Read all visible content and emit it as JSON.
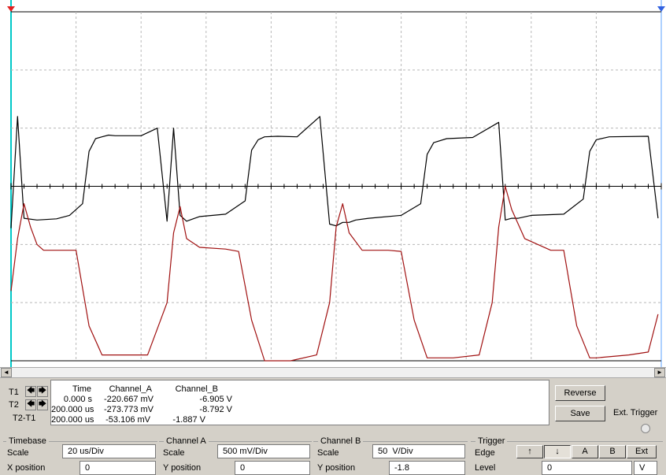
{
  "chart_data": {
    "type": "line",
    "title": "",
    "xlabel": "",
    "ylabel": "",
    "grid": true,
    "x_divisions": 10,
    "y_divisions": 6,
    "timebase_us_per_div": 20,
    "series": [
      {
        "channel": "Channel A",
        "color": "#000000",
        "x": [
          0,
          2,
          4,
          8,
          14,
          18,
          22,
          24,
          26,
          28,
          30,
          32,
          40,
          45,
          48,
          50,
          52,
          54,
          56,
          58,
          66,
          72,
          74,
          76,
          78,
          82,
          88,
          95,
          98,
          100,
          102,
          104,
          106,
          110,
          120,
          126,
          128,
          130,
          134,
          142,
          150,
          152,
          154,
          156,
          160,
          170,
          176,
          178,
          180,
          184,
          196,
          199
        ],
        "y": [
          -0.72,
          1.2,
          -0.55,
          -0.58,
          -0.56,
          -0.5,
          -0.3,
          0.6,
          0.82,
          0.85,
          0.88,
          0.87,
          0.87,
          1.0,
          -0.6,
          1.0,
          -0.5,
          -0.6,
          -0.56,
          -0.52,
          -0.48,
          -0.25,
          0.62,
          0.8,
          0.85,
          0.86,
          0.85,
          1.2,
          -0.65,
          -0.68,
          -0.62,
          -0.62,
          -0.58,
          -0.55,
          -0.5,
          -0.3,
          0.55,
          0.75,
          0.82,
          0.84,
          1.1,
          -0.58,
          -0.55,
          -0.55,
          -0.5,
          -0.48,
          -0.22,
          0.6,
          0.8,
          0.85,
          0.86,
          -0.55
        ]
      },
      {
        "channel": "Channel B",
        "color": "#a01010",
        "x": [
          0,
          2,
          4,
          6,
          8,
          10,
          14,
          20,
          24,
          28,
          30,
          34,
          42,
          48,
          50,
          52,
          54,
          58,
          66,
          70,
          74,
          78,
          80,
          86,
          94,
          98,
          100,
          102,
          104,
          108,
          116,
          120,
          124,
          128,
          130,
          136,
          144,
          148,
          150,
          152,
          154,
          158,
          166,
          170,
          174,
          178,
          180,
          190,
          196,
          199
        ],
        "y": [
          -1.8,
          -0.9,
          -0.3,
          -0.7,
          -1.0,
          -1.1,
          -1.1,
          -1.1,
          -2.4,
          -2.9,
          -2.9,
          -2.9,
          -2.9,
          -2.0,
          -0.8,
          -0.35,
          -0.9,
          -1.05,
          -1.08,
          -1.12,
          -2.3,
          -3.0,
          -3.0,
          -3.0,
          -2.9,
          -2.0,
          -0.7,
          -0.3,
          -0.8,
          -1.1,
          -1.1,
          -1.12,
          -2.3,
          -2.95,
          -2.95,
          -2.95,
          -2.9,
          -2.0,
          -0.7,
          -0.0,
          -0.4,
          -0.9,
          -1.1,
          -1.1,
          -2.4,
          -2.95,
          -2.95,
          -2.9,
          -2.85,
          -2.2
        ]
      }
    ]
  },
  "scrollbar": {
    "left": "◄",
    "right": "►"
  },
  "readout": {
    "row_labels": [
      "T1",
      "T2",
      "T2-T1"
    ],
    "arrows": {
      "left": "🡄",
      "right": "🡆"
    },
    "headers": {
      "time": "Time",
      "a": "Channel_A",
      "b": "Channel_B"
    },
    "rows": [
      {
        "time": "0.000 s",
        "a": "-220.667 mV",
        "b": "-6.905 V"
      },
      {
        "time": "200.000 us",
        "a": "-273.773 mV",
        "b": "-8.792 V"
      },
      {
        "time": "200.000 us",
        "a": "-53.106 mV",
        "b": "-1.887 V"
      }
    ]
  },
  "buttons": {
    "reverse": "Reverse",
    "save": "Save",
    "ext_trigger": "Ext. Trigger"
  },
  "timebase": {
    "title": "Timebase",
    "scale_label": "Scale",
    "scale_value": "20 us/Div",
    "pos_label": "X position",
    "pos_value": "0"
  },
  "channel_a": {
    "title": "Channel A",
    "scale_label": "Scale",
    "scale_value": "500 mV/Div",
    "pos_label": "Y position",
    "pos_value": "0"
  },
  "channel_b": {
    "title": "Channel B",
    "scale_label": "Scale",
    "scale_value": "50  V/Div",
    "pos_label": "Y position",
    "pos_value": "-1.8"
  },
  "trigger": {
    "title": "Trigger",
    "edge_label": "Edge",
    "level_label": "Level",
    "level_value": "0",
    "level_unit": "V",
    "edge_rise": "↑",
    "edge_fall": "↓",
    "src_a": "A",
    "src_b": "B",
    "src_ext": "Ext"
  }
}
